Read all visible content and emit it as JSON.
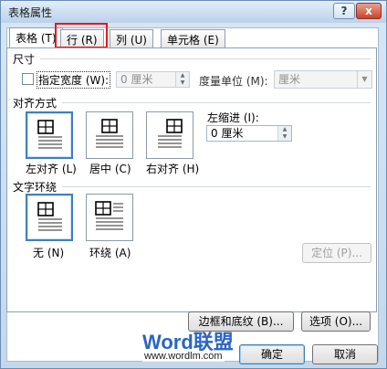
{
  "window": {
    "title": "表格属性",
    "help_label": "?",
    "close_label": "x"
  },
  "tabs": [
    {
      "label": "表格 (T)",
      "active": true
    },
    {
      "label": "行 (R)",
      "active": false
    },
    {
      "label": "列 (U)",
      "active": false
    },
    {
      "label": "单元格 (E)",
      "active": false
    }
  ],
  "size": {
    "section_label": "尺寸",
    "specify_width_label": "指定宽度 (W):",
    "specify_width_checked": false,
    "width_value": "0 厘米",
    "unit_label": "度量单位 (M):",
    "unit_value": "厘米"
  },
  "alignment": {
    "section_label": "对齐方式",
    "options": [
      {
        "label": "左对齐 (L)",
        "icon": "align-left-icon",
        "selected": true
      },
      {
        "label": "居中 (C)",
        "icon": "align-center-icon",
        "selected": false
      },
      {
        "label": "右对齐 (H)",
        "icon": "align-right-icon",
        "selected": false
      }
    ],
    "indent_label": "左缩进 (I):",
    "indent_value": "0 厘米"
  },
  "wrapping": {
    "section_label": "文字环绕",
    "options": [
      {
        "label": "无 (N)",
        "icon": "wrap-none-icon",
        "selected": true
      },
      {
        "label": "环绕 (A)",
        "icon": "wrap-around-icon",
        "selected": false
      }
    ],
    "position_button": "定位 (P)..."
  },
  "buttons": {
    "borders_shading": "边框和底纹 (B)...",
    "options": "选项 (O)...",
    "ok": "确定",
    "cancel": "取消"
  },
  "watermark": {
    "brand": "Word联盟",
    "url": "www.wordlm.com"
  },
  "colors": {
    "highlight_box": "#e41a1a",
    "selected_tile": "#3f7fbf",
    "title_gradient_top": "#e3eef9",
    "brand_blue": "#2a66c2"
  }
}
